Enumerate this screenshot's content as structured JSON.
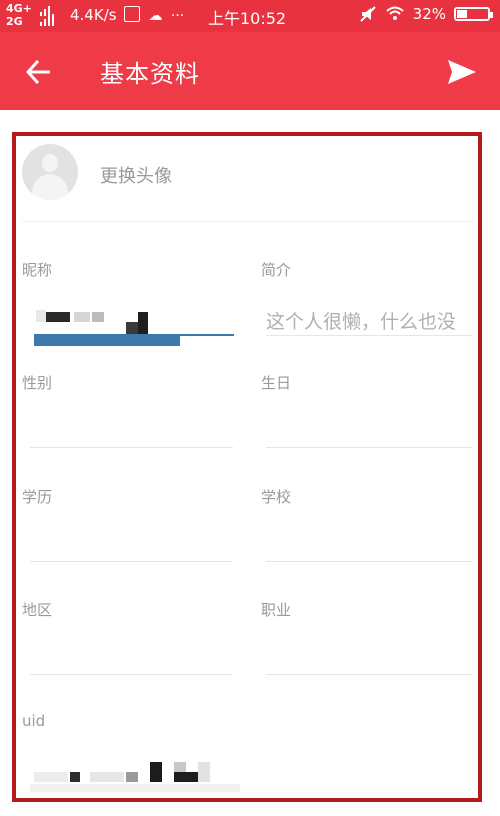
{
  "status_bar": {
    "network_top": "4G+",
    "network_bottom": "2G",
    "speed": "4.4K/s",
    "time": "上午10:52",
    "battery": "32%",
    "battery_level": 0.32
  },
  "app_bar": {
    "title": "基本资料"
  },
  "avatar": {
    "change_label": "更换头像"
  },
  "fields": {
    "nickname": {
      "label": "昵称"
    },
    "bio": {
      "label": "简介",
      "placeholder": "这个人很懒，什么也没"
    },
    "gender": {
      "label": "性别"
    },
    "birthday": {
      "label": "生日"
    },
    "education": {
      "label": "学历"
    },
    "school": {
      "label": "学校"
    },
    "region": {
      "label": "地区"
    },
    "occupation": {
      "label": "职业"
    },
    "uid": {
      "label": "uid"
    }
  },
  "colors": {
    "status_bar": "#e8323f",
    "app_bar": "#ef3b48",
    "highlight_frame": "#b61a1a",
    "label_text": "#9a9a9a"
  }
}
